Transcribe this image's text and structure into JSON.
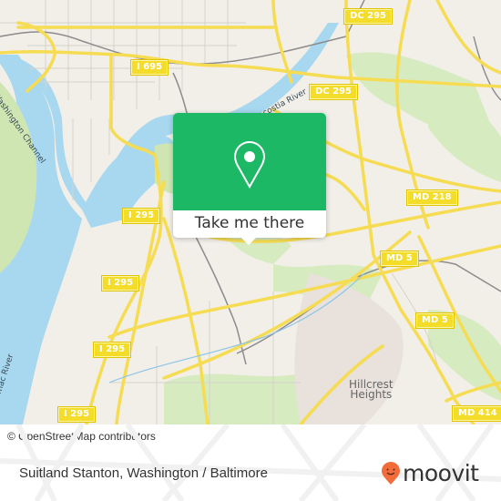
{
  "map": {
    "colors": {
      "land": "#f2efe9",
      "water": "#a7d8ef",
      "park": "#cfe6b2",
      "road_major": "#f6dc52",
      "road_minor": "#d9d5ce",
      "rail": "#8c8c8c",
      "accent": "#1db865"
    },
    "shields": [
      {
        "id": "dc295-top",
        "label": "DC 295"
      },
      {
        "id": "i695",
        "label": "I 695"
      },
      {
        "id": "dc295-mid",
        "label": "DC 295"
      },
      {
        "id": "i295-a",
        "label": "I 295"
      },
      {
        "id": "md218",
        "label": "MD 218"
      },
      {
        "id": "i295-b",
        "label": "I 295"
      },
      {
        "id": "md5-a",
        "label": "MD 5"
      },
      {
        "id": "md5-b",
        "label": "MD 5"
      },
      {
        "id": "i295-c",
        "label": "I 295"
      },
      {
        "id": "i295-d",
        "label": "I 295"
      },
      {
        "id": "md414",
        "label": "MD 414"
      }
    ],
    "labels": {
      "washington_channel": "Washington Channel",
      "anacostia_river": "Anacostia River",
      "potomac_river": "Potomac River",
      "hillcrest_1": "Hillcrest",
      "hillcrest_2": "Heights"
    },
    "attribution": "© OpenStreetMap contributors"
  },
  "popup": {
    "button_label": "Take me there",
    "icon": "map-pin-icon"
  },
  "footer": {
    "stop_name": "Suitland Stanton, Washington / Baltimore",
    "brand": "moovit",
    "brand_color": "#f26b3a"
  }
}
